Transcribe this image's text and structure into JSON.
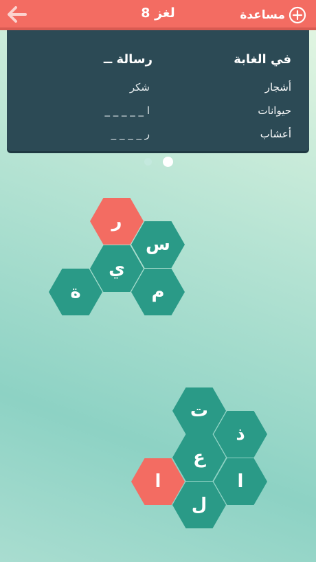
{
  "header": {
    "back_icon": "arrow-left-icon",
    "title": "لغز 8",
    "help_label": "مساعدة",
    "help_icon": "plus-circle-icon"
  },
  "colors": {
    "header": "#f36c62",
    "panel": "#2c4a55",
    "tile": "#2a9a87",
    "tile_selected": "#f36c62"
  },
  "clue_panel": {
    "category": "في الغابة",
    "items": [
      "أشجار",
      "حيوانات",
      "أعشاب"
    ],
    "answer_title": "رسالة ــ",
    "answers": [
      "شكر",
      "ا _ _ _ _ _",
      "ر _ _ _ _"
    ]
  },
  "page_dots": {
    "count": 2,
    "active": 2
  },
  "tile_groups": [
    {
      "tiles": [
        {
          "letter": "ر",
          "selected": true
        },
        {
          "letter": "س",
          "selected": false
        },
        {
          "letter": "ي",
          "selected": false
        },
        {
          "letter": "ة",
          "selected": false
        },
        {
          "letter": "م",
          "selected": false
        }
      ]
    },
    {
      "tiles": [
        {
          "letter": "ت",
          "selected": false
        },
        {
          "letter": "ذ",
          "selected": false
        },
        {
          "letter": "ع",
          "selected": false
        },
        {
          "letter": "ا",
          "selected": true
        },
        {
          "letter": "ا",
          "selected": false
        },
        {
          "letter": "ل",
          "selected": false
        }
      ]
    }
  ]
}
